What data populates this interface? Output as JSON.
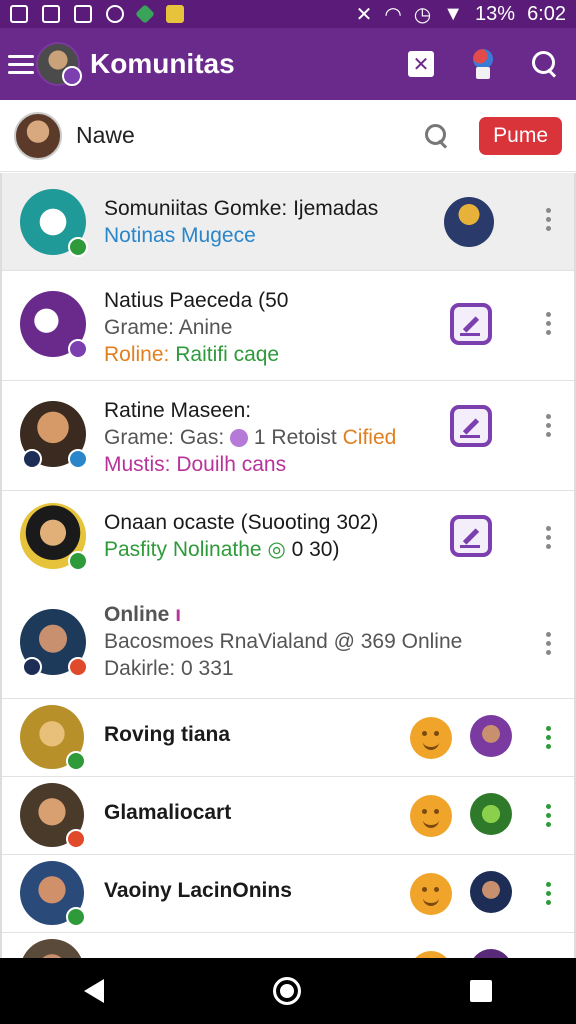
{
  "status_bar": {
    "battery": "13%",
    "time": "6:02"
  },
  "app_bar": {
    "title": "Komunitas"
  },
  "user": {
    "name": "Nawe",
    "button_label": "Pume"
  },
  "items": [
    {
      "line1": "Somuniitas Gomke: Ijemadas",
      "line2": "Notinas Mugece"
    },
    {
      "line1_a": "Natius",
      "line1_b": "Paeceda (50",
      "line2": "Grame: Anine",
      "line3_a": "Roline:",
      "line3_b": "Raitifi caqe"
    },
    {
      "line1_a": "Ratine",
      "line1_b": "Maseen:",
      "line2_a": "Grame: Gas:",
      "line2_b": "1 Retoist",
      "line2_c": "Cified",
      "line3": "Mustis: Douilh cans"
    },
    {
      "line1": "Onaan ocaste (Suooting 302)",
      "line2": "Pasfity Nolinathe",
      "line2_b": "0 30)"
    },
    {
      "line1": "Online",
      "line1_mark": "ı",
      "line2": "Bacosmoes RnaVialand @ 369 Online",
      "line3": "Dakirle: 0 331"
    },
    {
      "name": "Roving tiana"
    },
    {
      "name": "Glamaliocart"
    },
    {
      "name": "Vaoiny LacinOnins"
    }
  ],
  "colors": {
    "app_bar": "#6a2a8c",
    "status_bar": "#5a1c78",
    "accent_purple": "#7b3fb0",
    "button_red": "#d9343a",
    "link_blue": "#2a86c9",
    "online_green": "#2e9a3a",
    "highlight_orange": "#e07f1f"
  },
  "icons": [
    "menu-icon",
    "search-icon",
    "more-vert-icon",
    "edit-icon",
    "emoji-icon",
    "back-icon",
    "home-icon",
    "recents-icon"
  ]
}
